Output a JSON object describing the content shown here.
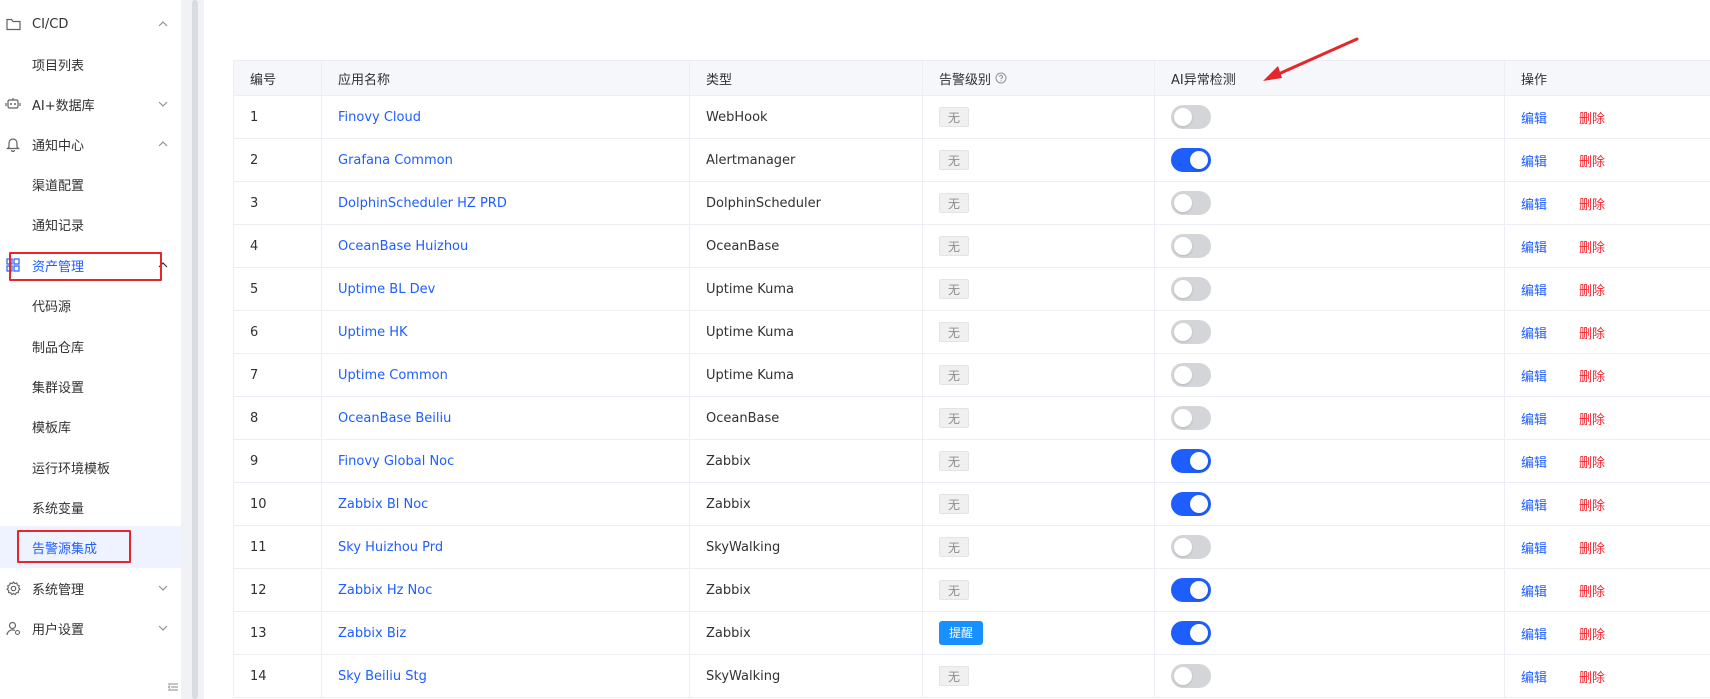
{
  "sidebar": {
    "items": [
      {
        "label": "CI/CD",
        "icon": "folder-icon",
        "chevron": "up"
      },
      {
        "label": "项目列表"
      },
      {
        "label": "AI+数据库",
        "icon": "robot-icon",
        "chevron": "down"
      },
      {
        "label": "通知中心",
        "icon": "bell-icon",
        "chevron": "up"
      },
      {
        "label": "渠道配置"
      },
      {
        "label": "通知记录"
      },
      {
        "label": "资产管理",
        "icon": "grid-icon",
        "chevron": "up"
      },
      {
        "label": "代码源"
      },
      {
        "label": "制品仓库"
      },
      {
        "label": "集群设置"
      },
      {
        "label": "模板库"
      },
      {
        "label": "运行环境模板"
      },
      {
        "label": "系统变量"
      },
      {
        "label": "告警源集成"
      },
      {
        "label": "系统管理",
        "icon": "gear-icon",
        "chevron": "down"
      },
      {
        "label": "用户设置",
        "icon": "user-settings-icon",
        "chevron": "down"
      }
    ]
  },
  "table": {
    "headers": [
      "编号",
      "应用名称",
      "类型",
      "告警级别",
      "AI异常检测",
      "操作"
    ],
    "rows": [
      {
        "id": "1",
        "name": "Finovy Cloud",
        "type": "WebHook",
        "level": "无",
        "ai": false
      },
      {
        "id": "2",
        "name": "Grafana Common",
        "type": "Alertmanager",
        "level": "无",
        "ai": true
      },
      {
        "id": "3",
        "name": "DolphinScheduler HZ PRD",
        "type": "DolphinScheduler",
        "level": "无",
        "ai": false
      },
      {
        "id": "4",
        "name": "OceanBase Huizhou",
        "type": "OceanBase",
        "level": "无",
        "ai": false
      },
      {
        "id": "5",
        "name": "Uptime BL Dev",
        "type": "Uptime Kuma",
        "level": "无",
        "ai": false
      },
      {
        "id": "6",
        "name": "Uptime HK",
        "type": "Uptime Kuma",
        "level": "无",
        "ai": false
      },
      {
        "id": "7",
        "name": "Uptime Common",
        "type": "Uptime Kuma",
        "level": "无",
        "ai": false
      },
      {
        "id": "8",
        "name": "OceanBase Beiliu",
        "type": "OceanBase",
        "level": "无",
        "ai": false
      },
      {
        "id": "9",
        "name": "Finovy Global Noc",
        "type": "Zabbix",
        "level": "无",
        "ai": true
      },
      {
        "id": "10",
        "name": "Zabbix Bl Noc",
        "type": "Zabbix",
        "level": "无",
        "ai": true
      },
      {
        "id": "11",
        "name": "Sky Huizhou Prd",
        "type": "SkyWalking",
        "level": "无",
        "ai": false
      },
      {
        "id": "12",
        "name": "Zabbix Hz Noc",
        "type": "Zabbix",
        "level": "无",
        "ai": true
      },
      {
        "id": "13",
        "name": "Zabbix Biz",
        "type": "Zabbix",
        "level": "提醒",
        "ai": true
      },
      {
        "id": "14",
        "name": "Sky Beiliu Stg",
        "type": "SkyWalking",
        "level": "无",
        "ai": false
      }
    ],
    "actions": {
      "edit": "编辑",
      "delete": "删除"
    }
  },
  "colors": {
    "accent": "#1e5eff",
    "danger": "#f5222d",
    "highlight": "#e5262b",
    "info_tag": "#1890ff"
  }
}
